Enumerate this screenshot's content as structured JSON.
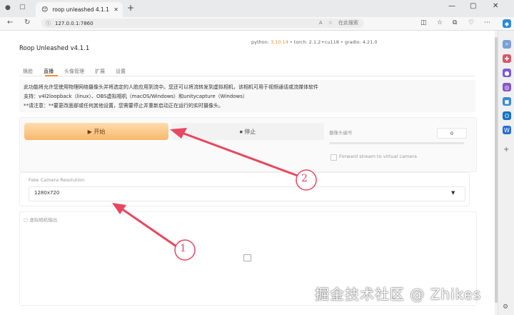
{
  "browser": {
    "tab_title": "roop unleashed 4.1.1",
    "url": "127.0.0.1:7860",
    "search_placeholder": "在此搜索",
    "new_tab_glyph": "+",
    "close_glyph": "✕"
  },
  "header": {
    "title": "Roop Unleashed v4.1.1",
    "versions_prefix": "python: ",
    "python": "3.10.14",
    "sep1": " • torch: 2.1.2+cu118 • gradio: 4.21.0"
  },
  "tabs": [
    "换脸",
    "直播",
    "头像管理",
    "扩展",
    "设置"
  ],
  "info": {
    "line1": "此功能将允许您使用物理网络摄像头并将选定的人脸应用到流中。您还可以将流转发到虚拟相机，该相机可用于视频通话或流媒体软件",
    "line2": "支持：v4l2loopback（linux）、OBS虚拟相机（macOS/Windows）和unitycapture（Windows）",
    "line3": "**请注意：**要更改面部或任何其他设置，您需要停止并重新启动正在运行的实时摄像头。"
  },
  "controls": {
    "start_label": "▶ 开始",
    "stop_label": "⏹ 停止",
    "camera_num_label": "摄像头编号",
    "camera_num_value": "0",
    "forward_label": "Forward stream to virtual camera"
  },
  "resolution": {
    "label": "Fake Camera Resolution",
    "value": "1280x720"
  },
  "output": {
    "label": "虚拟相机输出"
  },
  "annotations": {
    "circle1": "1",
    "circle2": "2",
    "watermark": "掘金技术社区 @ Zhikes"
  },
  "colors": {
    "accent": "#f08d3c",
    "arrow": "#e8475f"
  }
}
